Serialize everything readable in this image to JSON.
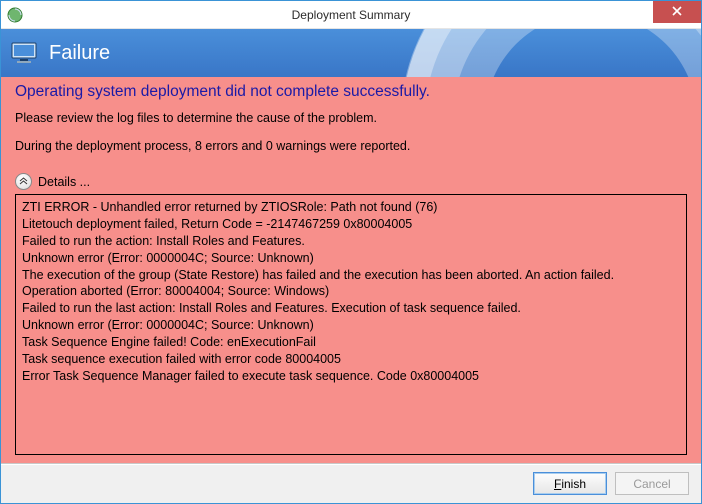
{
  "window": {
    "title": "Deployment Summary"
  },
  "header": {
    "text": "Failure"
  },
  "content": {
    "heading": "Operating system deployment did not complete successfully.",
    "review_msg": "Please review the log files to determine the cause of the problem.",
    "errors_msg": "During the deployment process, 8 errors and 0 warnings were reported.",
    "details_label": "Details ...",
    "log_lines": [
      "ZTI ERROR - Unhandled error returned by ZTIOSRole: Path not found (76)",
      "Litetouch deployment failed, Return Code = -2147467259  0x80004005",
      "Failed to run the action: Install Roles and Features.",
      "Unknown error (Error: 0000004C; Source: Unknown)",
      "The execution of the group (State Restore) has failed and the execution has been aborted. An action failed.",
      "Operation aborted (Error: 80004004; Source: Windows)",
      "Failed to run the last action: Install Roles and Features. Execution of task sequence failed.",
      "Unknown error (Error: 0000004C; Source: Unknown)",
      "Task Sequence Engine failed! Code: enExecutionFail",
      "Task sequence execution failed with error code 80004005",
      "Error Task Sequence Manager failed to execute task sequence. Code 0x80004005"
    ]
  },
  "footer": {
    "finish_label": "Finish",
    "cancel_label": "Cancel"
  }
}
